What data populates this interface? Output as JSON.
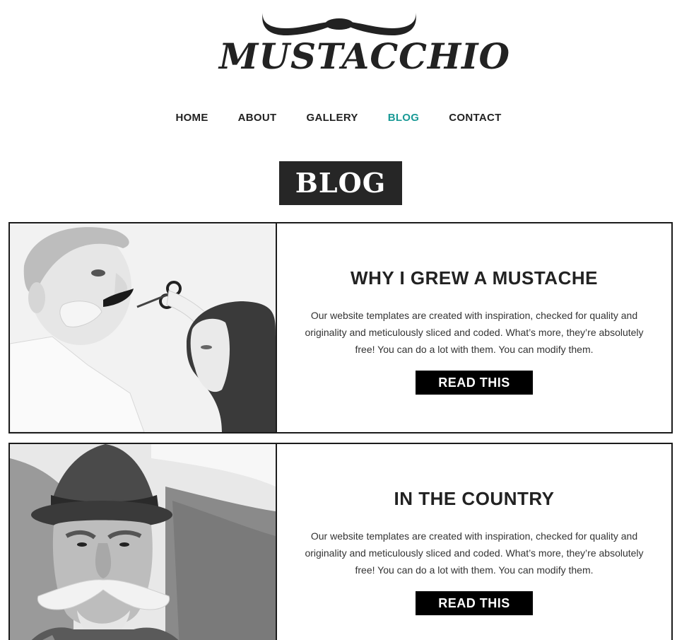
{
  "logo": {
    "text": "MUSTACCHIO"
  },
  "nav": {
    "items": [
      {
        "label": "HOME",
        "active": false
      },
      {
        "label": "ABOUT",
        "active": false
      },
      {
        "label": "GALLERY",
        "active": false
      },
      {
        "label": "BLOG",
        "active": true
      },
      {
        "label": "CONTACT",
        "active": false
      }
    ]
  },
  "page": {
    "title": "BLOG"
  },
  "posts": [
    {
      "title": "WHY I GREW A MUSTACHE",
      "text": "Our website templates are created with inspiration, checked for quality and originality and meticulously sliced and coded. What’s more, they’re absolutely free! You can do a lot with them. You can modify them.",
      "button": "READ THIS",
      "image": "man-with-fake-mustache-photo"
    },
    {
      "title": "IN THE COUNTRY",
      "text": "Our website templates are created with inspiration, checked for quality and originality and meticulously sliced and coded. What’s more, they’re absolutely free! You can do a lot with them. You can modify them.",
      "button": "READ THIS",
      "image": "old-man-with-hat-photo"
    }
  ],
  "colors": {
    "accent": "#1a9a96",
    "dark": "#262626",
    "button": "#000000"
  }
}
